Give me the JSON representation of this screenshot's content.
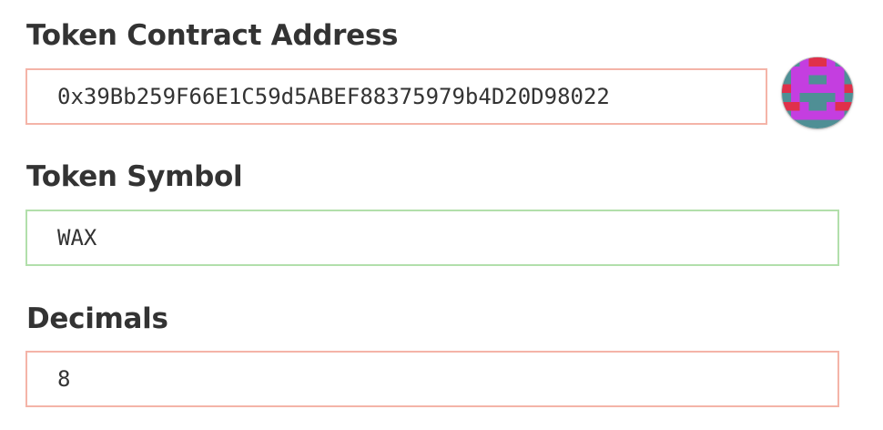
{
  "form": {
    "address_label": "Token Contract Address",
    "address_value": "0x39Bb259F66E1C59d5ABEF88375979b4D20D98022",
    "symbol_label": "Token Symbol",
    "symbol_value": "WAX",
    "decimals_label": "Decimals",
    "decimals_value": "8"
  },
  "identicon": {
    "icon": "token-identicon",
    "background_color": "#4f8f95",
    "primary_color": "#c43ee0",
    "spot_color": "#e0304a"
  },
  "colors": {
    "invalid_border": "#f4b4a8",
    "valid_border": "#b2dfab",
    "label_text": "#333333"
  }
}
